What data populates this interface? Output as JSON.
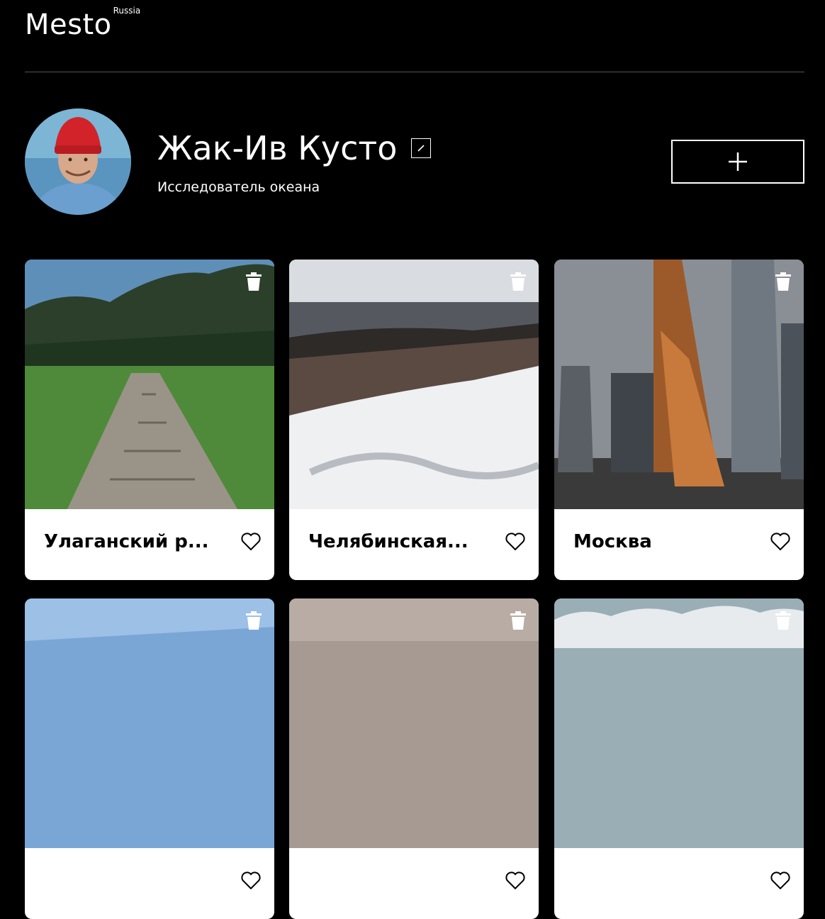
{
  "header": {
    "logo": "Mesto",
    "logo_sup": "Russia"
  },
  "profile": {
    "name": "Жак-Ив Кусто",
    "about": "Исследователь океана"
  },
  "cards": [
    {
      "title": "Улаганский р..."
    },
    {
      "title": "Челябинская..."
    },
    {
      "title": "Москва"
    },
    {
      "title": ""
    },
    {
      "title": ""
    },
    {
      "title": ""
    }
  ]
}
